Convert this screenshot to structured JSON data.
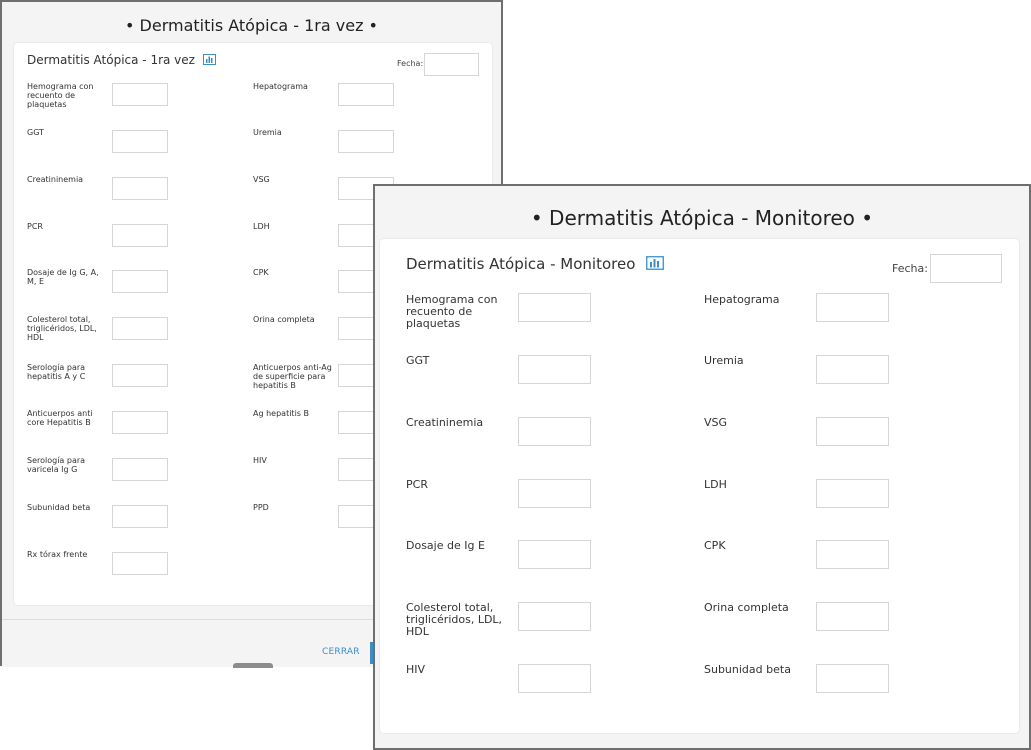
{
  "modal1": {
    "title": "• Dermatitis Atópica - 1ra vez •",
    "card_title": "Dermatitis Atópica - 1ra vez",
    "fecha_label": "Fecha:",
    "fields": [
      "Hemograma con recuento de plaquetas",
      "Hepatograma",
      "GGT",
      "Uremia",
      "Creatininemia",
      "VSG",
      "PCR",
      "LDH",
      "Dosaje de Ig G, A, M, E",
      "CPK",
      "Colesterol total, triglicéridos, LDL, HDL",
      "Orina completa",
      "Serología para hepatitis A y C",
      "Anticuerpos anti-Ag de superficie para hepatitis B",
      "Anticuerpos anti core Hepatitis B",
      "Ag hepatitis B",
      "Serología para varicela Ig G",
      "HIV",
      "Subunidad beta",
      "PPD",
      "Rx tórax frente"
    ],
    "close_label": "CERRAR"
  },
  "modal2": {
    "title": "• Dermatitis Atópica - Monitoreo •",
    "card_title": "Dermatitis Atópica - Monitoreo",
    "fecha_label": "Fecha:",
    "fields": [
      "Hemograma con recuento de plaquetas",
      "Hepatograma",
      "GGT",
      "Uremia",
      "Creatininemia",
      "VSG",
      "PCR",
      "LDH",
      "Dosaje de Ig E",
      "CPK",
      "Colesterol total, triglicéridos, LDL, HDL",
      "Orina completa",
      "HIV",
      "Subunidad beta"
    ]
  },
  "colors": {
    "accent": "#3a8fc8",
    "overlay_bg": "#f4f4f4",
    "border": "#6f6f6f"
  },
  "icons": {
    "chart": "bar-chart-icon"
  }
}
